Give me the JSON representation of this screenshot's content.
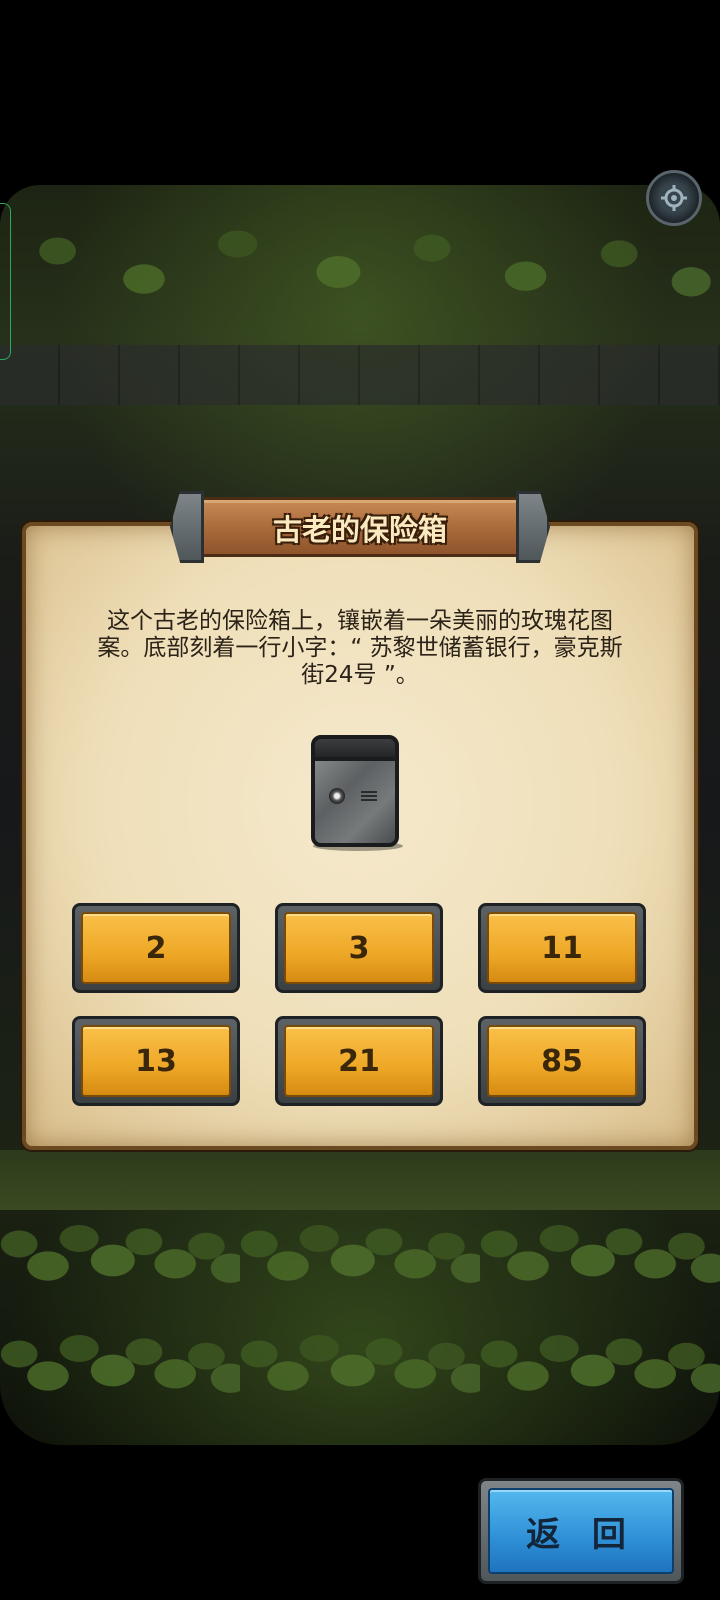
{
  "title": "古老的保险箱",
  "description": "这个古老的保险箱上，镶嵌着一朵美丽的玫瑰花图案。底部刻着一行小字：“ 苏黎世储蓄银行，豪克斯街24号 ”。",
  "item_icon": "safe-icon",
  "options": [
    "2",
    "3",
    "11",
    "13",
    "21",
    "85"
  ],
  "back_label": "返 回",
  "settings_icon": "gear-icon",
  "colors": {
    "panel": "#efdfb9",
    "option_button": "#eea726",
    "back_button": "#2f8fd6"
  }
}
